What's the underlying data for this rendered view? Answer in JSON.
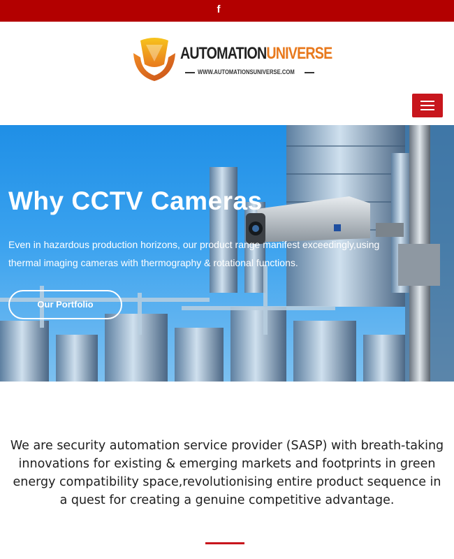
{
  "topbar": {
    "facebook_icon": "f",
    "color": "#b30000"
  },
  "logo": {
    "word1": "AUTOMATION",
    "word2": "UNIVERSE",
    "url": "WWW.AUTOMATIONSUNIVERSE.COM",
    "colors": {
      "word1": "#222222",
      "word2": "#e8791d",
      "emblem": "#e8791d"
    }
  },
  "nav": {
    "menu_icon": "hamburger-icon",
    "color": "#c8161d"
  },
  "hero": {
    "title": "Why CCTV Cameras",
    "text": "Even in hazardous production horizons, our product range manifest exceedingly,using thermal imaging cameras with thermography & rotational functions.",
    "cta_label": "Our Portfolio"
  },
  "intro": {
    "text": "We are security automation service provider (SASP) with breath-taking innovations for existing & emerging markets and footprints in green energy compatibility space,revolutionising entire product sequence in a quest for creating a genuine competitive advantage."
  }
}
